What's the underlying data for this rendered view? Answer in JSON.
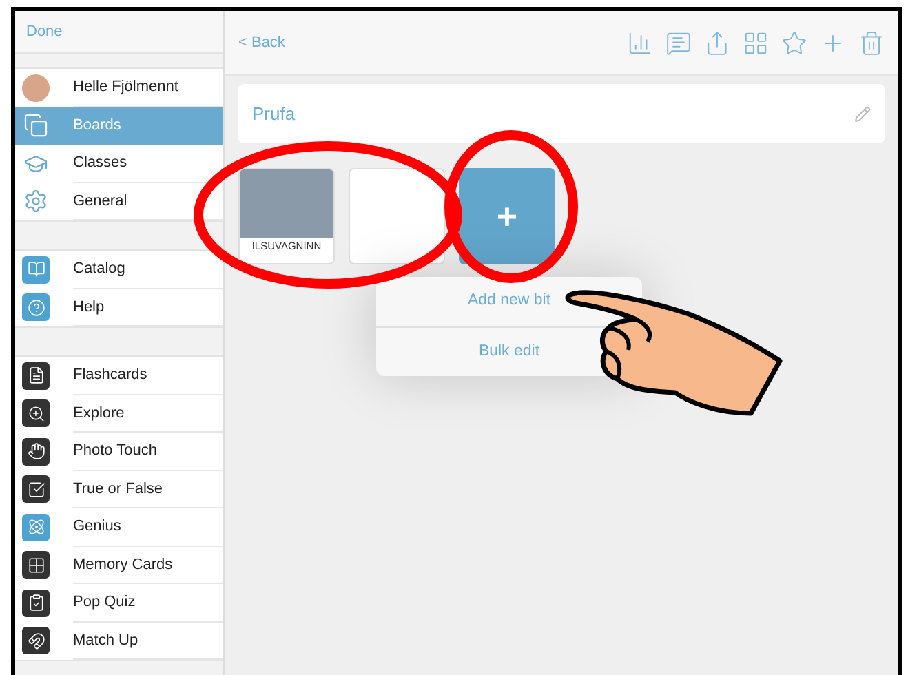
{
  "sidebar": {
    "done": "Done",
    "sections": [
      {
        "items": [
          {
            "label": "Helle Fjölmennt",
            "kind": "avatar",
            "selected": false
          },
          {
            "label": "Boards",
            "kind": "icon",
            "selected": true
          },
          {
            "label": "Classes",
            "kind": "icon",
            "selected": false
          },
          {
            "label": "General",
            "kind": "icon",
            "selected": false
          }
        ]
      },
      {
        "items": [
          {
            "label": "Catalog",
            "kind": "icon",
            "selected": false
          },
          {
            "label": "Help",
            "kind": "icon",
            "selected": false
          }
        ]
      },
      {
        "items": [
          {
            "label": "Flashcards",
            "kind": "icon",
            "selected": false
          },
          {
            "label": "Explore",
            "kind": "icon",
            "selected": false
          },
          {
            "label": "Photo Touch",
            "kind": "icon",
            "selected": false
          },
          {
            "label": "True or False",
            "kind": "icon",
            "selected": false
          },
          {
            "label": "Genius",
            "kind": "icon",
            "selected": false
          },
          {
            "label": "Memory Cards",
            "kind": "icon",
            "selected": false
          },
          {
            "label": "Pop Quiz",
            "kind": "icon",
            "selected": false
          },
          {
            "label": "Match Up",
            "kind": "icon",
            "selected": false
          }
        ]
      }
    ]
  },
  "toolbar": {
    "back": "< Back"
  },
  "board": {
    "title": "Prufa",
    "bits": [
      {
        "kind": "photo",
        "label": "ILSUVAGNINN"
      },
      {
        "kind": "blank"
      },
      {
        "kind": "add",
        "icon": "+"
      }
    ]
  },
  "popover": {
    "items": [
      "Add new bit",
      "Bulk edit"
    ]
  }
}
